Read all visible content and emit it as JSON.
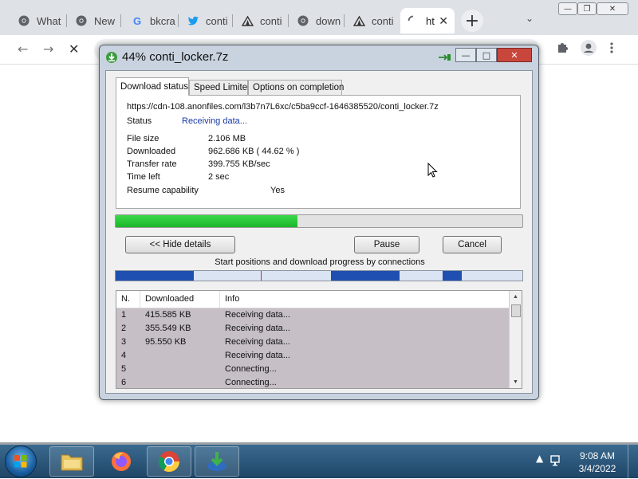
{
  "browser": {
    "tabs": [
      {
        "title": "What",
        "icon": "chrome-icon"
      },
      {
        "title": "New",
        "icon": "chrome-icon"
      },
      {
        "title": "bkcra",
        "icon": "google-icon"
      },
      {
        "title": "conti",
        "icon": "twitter-icon"
      },
      {
        "title": "conti",
        "icon": "tent-icon"
      },
      {
        "title": "down",
        "icon": "chrome-icon"
      },
      {
        "title": "conti",
        "icon": "tent-icon"
      },
      {
        "title": "ht",
        "icon": "loading-icon"
      }
    ],
    "new_tab_symbol": "+",
    "tab_search_symbol": "⌄",
    "close_tab_symbol": "✕",
    "window_controls": {
      "minimize": "—",
      "maximize": "❐",
      "close": "✕"
    },
    "toolbar": {
      "back": "←",
      "forward": "→",
      "stop": "✕"
    }
  },
  "idm_dialog": {
    "title": "44% conti_locker.7z",
    "window_controls": {
      "minimize": "—",
      "maximize": "□",
      "close": "✕"
    },
    "tabs": [
      "Download status",
      "Speed Limiter",
      "Options on completion"
    ],
    "active_tab": "Download status",
    "url": "https://cdn-108.anonfiles.com/l3b7n7L6xc/c5ba9ccf-1646385520/conti_locker.7z",
    "status_label": "Status",
    "status_value": "Receiving data...",
    "fields": [
      {
        "label": "File size",
        "value": "2.106  MB"
      },
      {
        "label": "Downloaded",
        "value": "962.686  KB  ( 44.62 % )"
      },
      {
        "label": "Transfer rate",
        "value": "399.755  KB/sec"
      },
      {
        "label": "Time left",
        "value": "2 sec"
      },
      {
        "label": "Resume capability",
        "value": "Yes"
      }
    ],
    "progress_fraction": 0.4462,
    "buttons": {
      "hide_details": "<< Hide details",
      "pause": "Pause",
      "cancel": "Cancel"
    },
    "connections_caption": "Start positions and download progress by connections",
    "connections_table": {
      "headers": [
        "N.",
        "Downloaded",
        "Info"
      ],
      "rows": [
        {
          "n": "1",
          "downloaded": "415.585  KB",
          "info": "Receiving data..."
        },
        {
          "n": "2",
          "downloaded": "355.549  KB",
          "info": "Receiving data..."
        },
        {
          "n": "3",
          "downloaded": "95.550  KB",
          "info": "Receiving data..."
        },
        {
          "n": "4",
          "downloaded": "",
          "info": "Receiving data..."
        },
        {
          "n": "5",
          "downloaded": "",
          "info": "Connecting..."
        },
        {
          "n": "6",
          "downloaded": "",
          "info": "Connecting..."
        }
      ]
    }
  },
  "taskbar": {
    "apps": [
      "file-explorer-icon",
      "firefox-icon",
      "chrome-icon",
      "idm-icon"
    ],
    "clock_time": "9:08 AM",
    "clock_date": "3/4/2022"
  },
  "colors": {
    "progress_green": "#1cb52b",
    "connection_blue": "#1f4fb0",
    "status_blue": "#1a3aa6",
    "taskbar": "#2a5678"
  }
}
